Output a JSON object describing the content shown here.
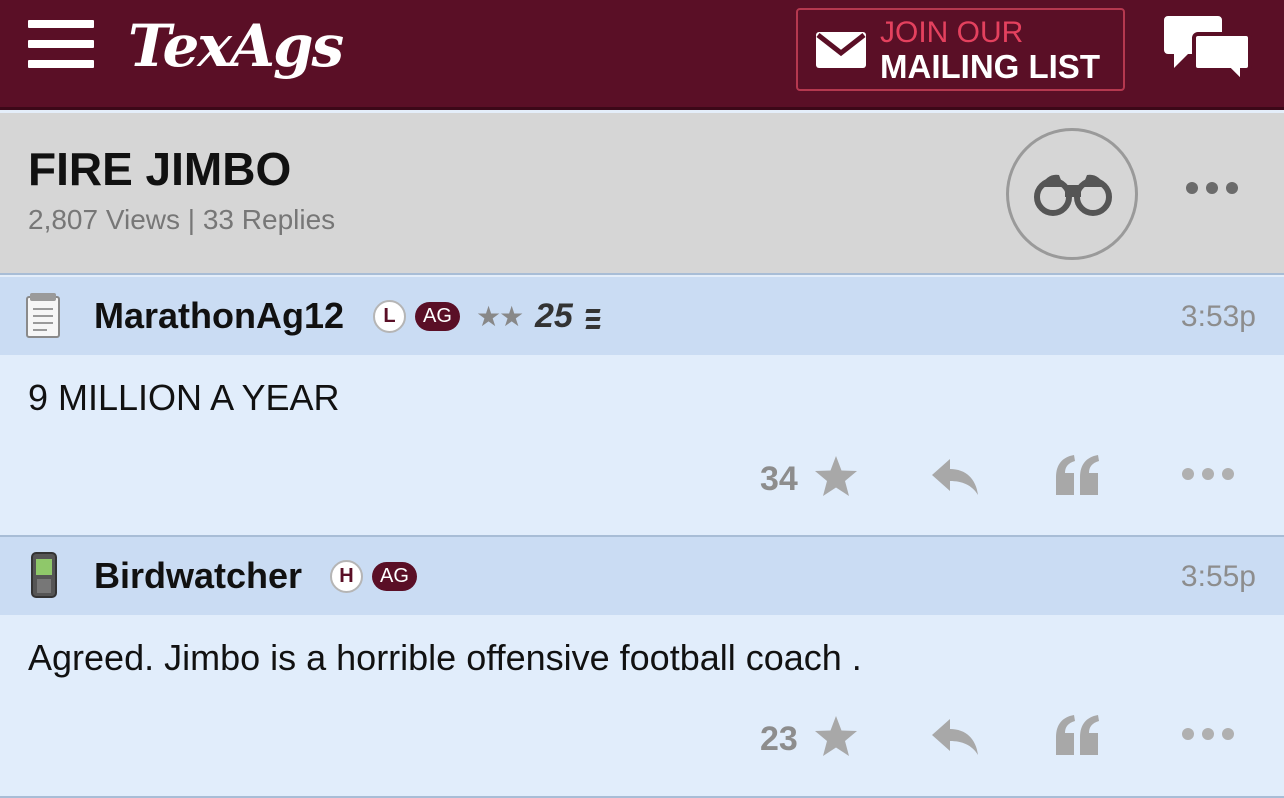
{
  "header": {
    "logo": "TexAgs",
    "mailing_line1": "JOIN OUR",
    "mailing_line2": "MAILING LIST",
    "brand_color": "#5a0f26",
    "accent_color": "#e4415e"
  },
  "thread": {
    "title": "FIRE JIMBO",
    "stats": "2,807 Views | 33 Replies"
  },
  "posts": [
    {
      "author": "MarathonAg12",
      "badge_letter": "L",
      "badge_tag": "AG",
      "stars": "★★",
      "tier": "25",
      "timestamp": "3:53p",
      "text": "9 MILLION A YEAR",
      "likes": "34",
      "device_icon": "notepad-icon"
    },
    {
      "author": "Birdwatcher",
      "badge_letter": "H",
      "badge_tag": "AG",
      "timestamp": "3:55p",
      "text": "Agreed. Jimbo is a horrible offensive football coach .",
      "likes": "23",
      "device_icon": "mobile-phone-icon"
    }
  ],
  "icons": {
    "menu": "hamburger-menu-icon",
    "mail": "envelope-icon",
    "chat": "chat-bubbles-icon",
    "watch": "binoculars-icon",
    "more": "more-dots-icon",
    "star": "star-icon",
    "reply": "reply-icon",
    "quote": "quote-icon"
  }
}
